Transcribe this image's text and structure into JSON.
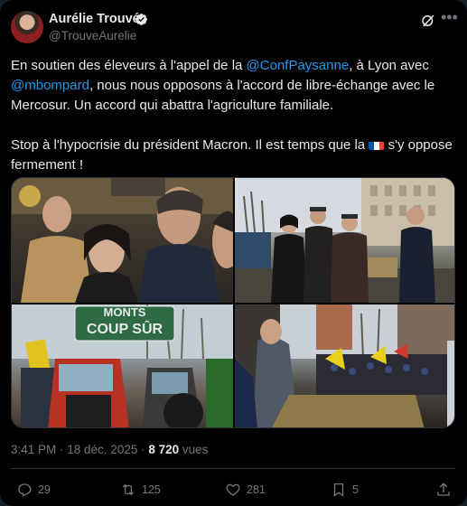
{
  "tweet": {
    "author_name": "Aurélie Trouvé",
    "author_handle": "@TrouveAurelie",
    "text_1": "En soutien des éleveurs à l'appel de la ",
    "mention_1": "@ConfPaysanne",
    "text_2": ", à Lyon avec ",
    "mention_2": "@mbompard",
    "text_3": ", nous nous opposons à l'accord de libre-échange avec le Mercosur. Un accord qui abattra l'agriculture familiale.\n\nStop à l'hypocrisie du président Macron. Il est temps que la ",
    "text_4": " s'y oppose fermement !",
    "sign_text_top": "MONTS",
    "sign_text": "COUP SÛR",
    "timestamp": "3:41 PM · 18 déc. 2025 · ",
    "views_count": "8 720",
    "views_label": " vues"
  },
  "actions": {
    "replies": "29",
    "reposts": "125",
    "likes": "281",
    "bookmarks": "5"
  },
  "colors": {
    "background": "#000000",
    "text": "#e7e9ea",
    "muted": "#71767b",
    "accent": "#1d9bf0"
  }
}
